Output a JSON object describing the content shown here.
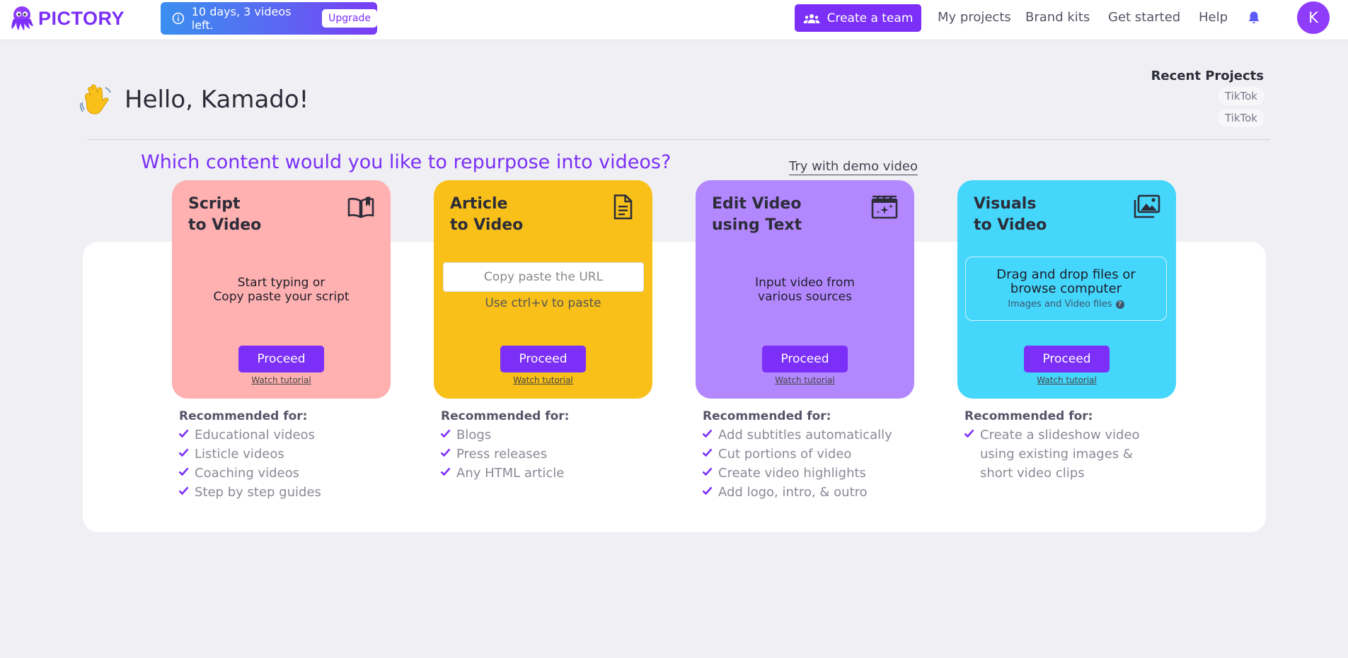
{
  "brand": {
    "name": "PICTORY",
    "color": "#7b2ff7"
  },
  "trial": {
    "message": "10 days, 3 videos left.",
    "upgrade_label": "Upgrade"
  },
  "nav": {
    "create_team_label": "Create a team",
    "my_projects": "My projects",
    "brand_kits": "Brand kits",
    "get_started": "Get started",
    "help": "Help"
  },
  "user": {
    "initial": "K",
    "greeting": "Hello, Kamado!"
  },
  "recent": {
    "title": "Recent Projects",
    "items": [
      "TikTok",
      "TikTok"
    ]
  },
  "question": "Which content would you like to repurpose into videos?",
  "demo_link": "Try with demo video",
  "cards": [
    {
      "title_line1": "Script",
      "title_line2": "to Video",
      "body_line1": "Start typing or",
      "body_line2": "Copy paste your script",
      "proceed": "Proceed",
      "tutorial": "Watch tutorial",
      "color": "#ffb0b0",
      "icon": "open-book-icon",
      "rec_title": "Recommended for:",
      "recommended": [
        "Educational videos",
        "Listicle videos",
        "Coaching videos",
        "Step by step guides"
      ]
    },
    {
      "title_line1": "Article",
      "title_line2": "to Video",
      "url_placeholder": "Copy paste the URL",
      "hint": "Use ctrl+v to paste",
      "proceed": "Proceed",
      "tutorial": "Watch tutorial",
      "color": "#f8c018",
      "icon": "document-icon",
      "rec_title": "Recommended for:",
      "recommended": [
        "Blogs",
        "Press releases",
        "Any HTML article"
      ]
    },
    {
      "title_line1": "Edit Video",
      "title_line2": "using Text",
      "body_line1": "Input video from",
      "body_line2": "various sources",
      "proceed": "Proceed",
      "tutorial": "Watch tutorial",
      "color": "#b388ff",
      "icon": "clapperboard-icon",
      "rec_title": "Recommended for:",
      "recommended": [
        "Add subtitles automatically",
        "Cut portions of video",
        "Create video highlights",
        "Add logo, intro, & outro"
      ]
    },
    {
      "title_line1": "Visuals",
      "title_line2": "to Video",
      "drop_line1": "Drag and drop files or",
      "drop_line2": "browse computer",
      "drop_sub": "Images and Video files",
      "proceed": "Proceed",
      "tutorial": "Watch tutorial",
      "color": "#44d6fb",
      "icon": "image-stack-icon",
      "rec_title": "Recommended for:",
      "recommended": [
        "Create a slideshow video",
        "using existing images &",
        "short video clips"
      ]
    }
  ]
}
